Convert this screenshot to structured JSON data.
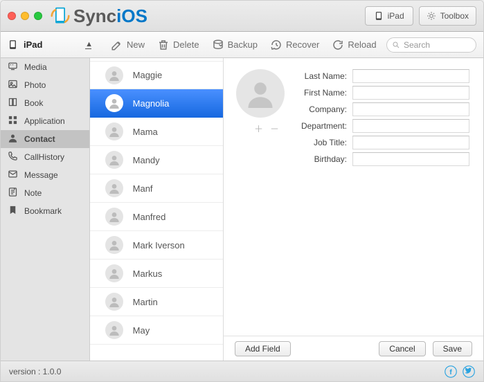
{
  "app": {
    "brand_prefix": "Sync",
    "brand_suffix": "iOS"
  },
  "titlebar": {
    "device_label": "iPad",
    "toolbox_label": "Toolbox"
  },
  "sidebar_head": {
    "device_label": "iPad"
  },
  "toolbar": {
    "new": "New",
    "delete": "Delete",
    "backup": "Backup",
    "recover": "Recover",
    "reload": "Reload",
    "search_placeholder": "Search"
  },
  "sidebar": {
    "items": [
      {
        "key": "media",
        "label": "Media"
      },
      {
        "key": "photo",
        "label": "Photo"
      },
      {
        "key": "book",
        "label": "Book"
      },
      {
        "key": "application",
        "label": "Application"
      },
      {
        "key": "contact",
        "label": "Contact"
      },
      {
        "key": "callhistory",
        "label": "CallHistory"
      },
      {
        "key": "message",
        "label": "Message"
      },
      {
        "key": "note",
        "label": "Note"
      },
      {
        "key": "bookmark",
        "label": "Bookmark"
      }
    ],
    "active_key": "contact"
  },
  "contacts": {
    "selected_index": 1,
    "items": [
      {
        "name": "Maggie"
      },
      {
        "name": "Magnolia"
      },
      {
        "name": "Mama"
      },
      {
        "name": "Mandy"
      },
      {
        "name": "Manf"
      },
      {
        "name": "Manfred"
      },
      {
        "name": "Mark Iverson"
      },
      {
        "name": "Markus"
      },
      {
        "name": "Martin"
      },
      {
        "name": "May"
      }
    ]
  },
  "detail": {
    "fields": [
      {
        "key": "last_name",
        "label": "Last Name:",
        "value": ""
      },
      {
        "key": "first_name",
        "label": "First Name:",
        "value": ""
      },
      {
        "key": "company",
        "label": "Company:",
        "value": ""
      },
      {
        "key": "department",
        "label": "Department:",
        "value": ""
      },
      {
        "key": "job_title",
        "label": "Job Title:",
        "value": ""
      },
      {
        "key": "birthday",
        "label": "Birthday:",
        "value": ""
      }
    ],
    "add_field_label": "Add Field",
    "cancel_label": "Cancel",
    "save_label": "Save"
  },
  "statusbar": {
    "version_label": "version :  1.0.0"
  }
}
